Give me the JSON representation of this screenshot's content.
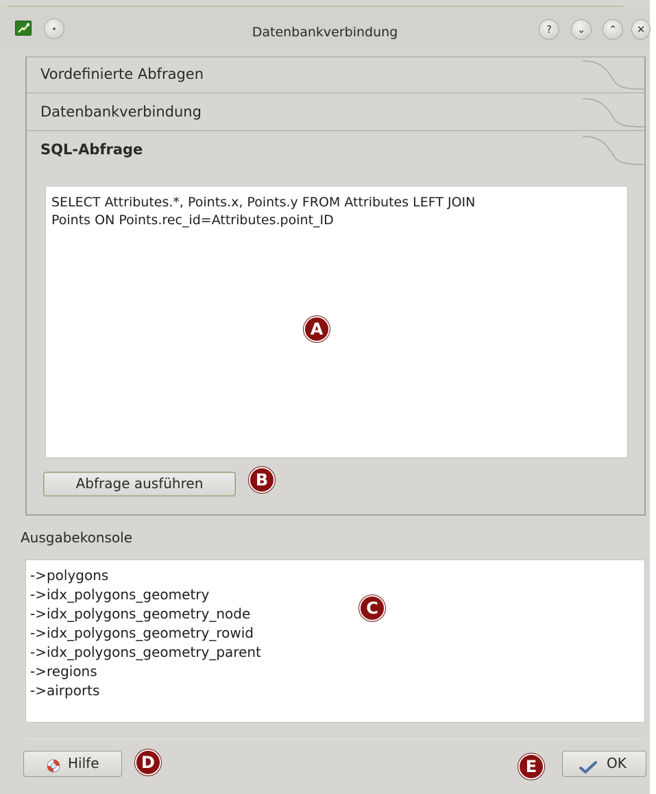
{
  "window": {
    "title": "Datenbankverbindung",
    "buttons": {
      "help_glyph": "?",
      "minimize_glyph": "⌄",
      "maximize_glyph": "⌃",
      "close_glyph": "✕"
    },
    "app_icon": "app-icon",
    "pin_icon": "pin-icon"
  },
  "toolbox": {
    "tabs": [
      {
        "label": "Vordefinierte Abfragen"
      },
      {
        "label": "Datenbankverbindung"
      },
      {
        "label": "SQL-Abfrage",
        "active": true
      }
    ]
  },
  "sql": {
    "query_lines": [
      "SELECT Attributes.*, Points.x, Points.y FROM Attributes LEFT JOIN",
      "Points ON Points.rec_id=Attributes.point_ID"
    ],
    "run_button": "Abfrage ausführen"
  },
  "console": {
    "label": "Ausgabekonsole",
    "lines": [
      "->polygons",
      "->idx_polygons_geometry",
      "->idx_polygons_geometry_node",
      "->idx_polygons_geometry_rowid",
      "->idx_polygons_geometry_parent",
      "->regions",
      "->airports"
    ]
  },
  "footer": {
    "help_button": "Hilfe",
    "help_icon": "help-lifebuoy-icon",
    "ok_button": "OK",
    "ok_icon": "checkmark-icon"
  },
  "markers": {
    "a": "A",
    "b": "B",
    "c": "C",
    "d": "D",
    "e": "E"
  },
  "colors": {
    "window_bg": "#d8d6d2",
    "marker": "#8a0f0f",
    "button_focus": "#b8c99a",
    "ok_check": "#4a6fa5"
  }
}
